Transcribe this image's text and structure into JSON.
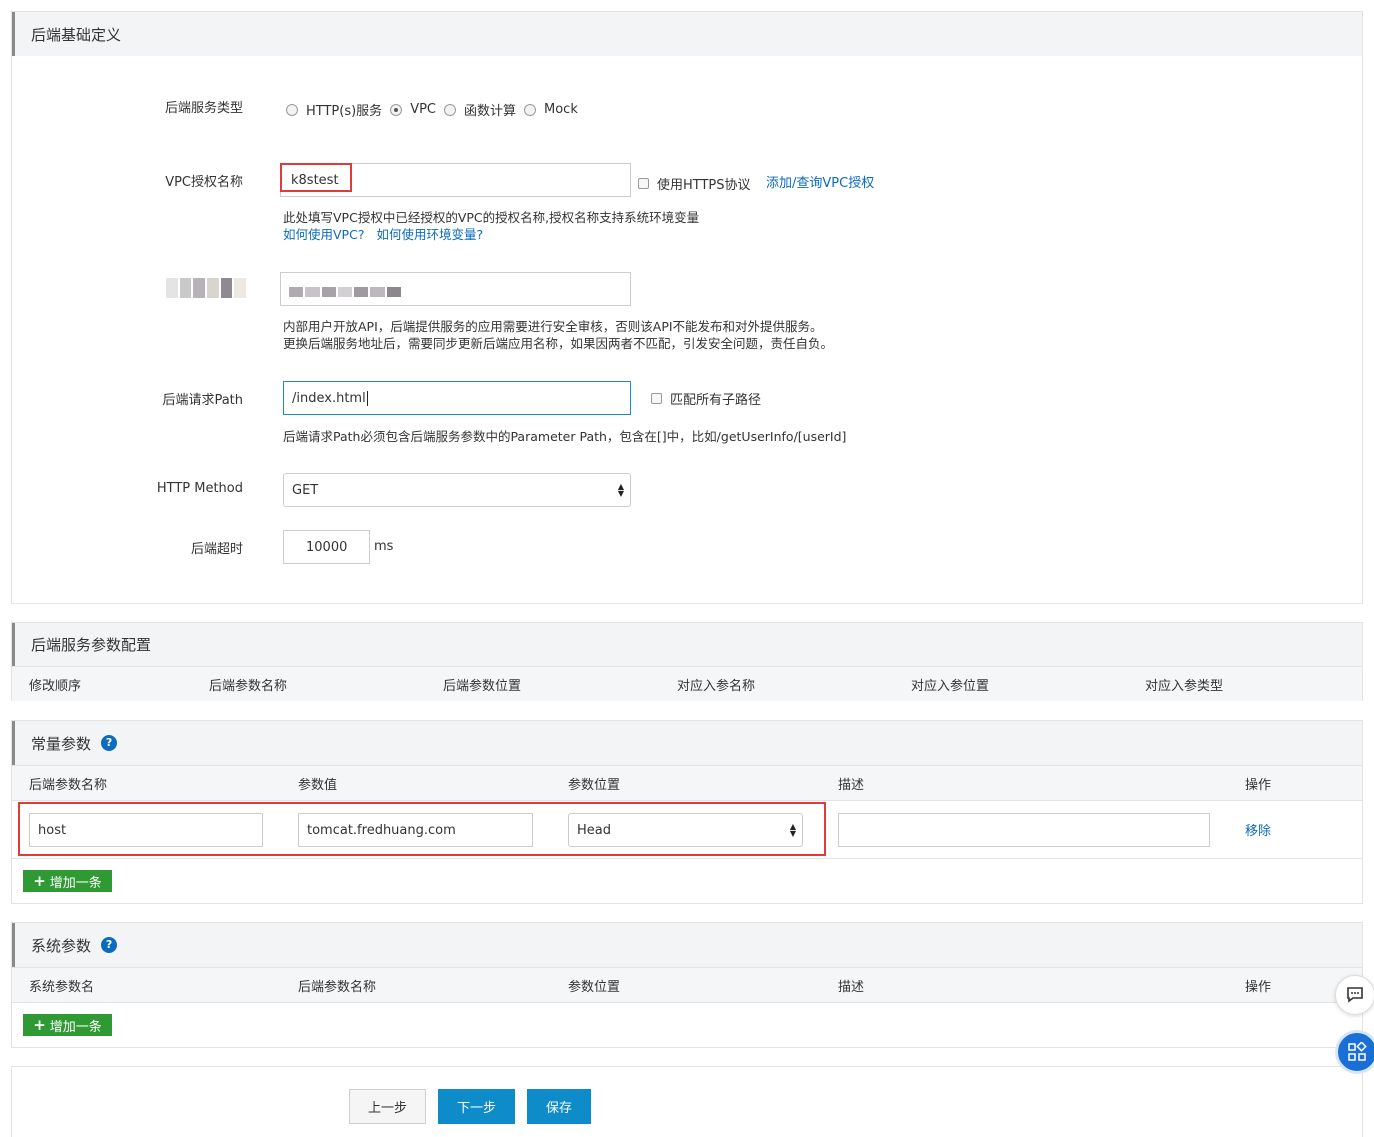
{
  "basic": {
    "title": "后端基础定义",
    "service_type_label": "后端服务类型",
    "service_types": [
      "HTTP(s)服务",
      "VPC",
      "函数计算",
      "Mock"
    ],
    "vpc_label": "VPC授权名称",
    "vpc_value": "k8stest",
    "https_label": "使用HTTPS协议",
    "vpc_link": "添加/查询VPC授权",
    "vpc_hint": "此处填写VPC授权中已经授权的VPC的授权名称,授权名称支持系统环境变量",
    "vpc_help_link1": "如何使用VPC?",
    "vpc_help_link2": "如何使用环境变量?",
    "app_hint": "内部用户开放API，后端提供服务的应用需要进行安全审核，否则该API不能发布和对外提供服务。",
    "app_warning": "更换后端服务地址后，需要同步更新后端应用名称，如果因两者不匹配，引发安全问题，责任自负。",
    "path_label": "后端请求Path",
    "path_value": "/index.html",
    "match_sub_label": "匹配所有子路径",
    "path_hint": "后端请求Path必须包含后端服务参数中的Parameter Path，包含在[]中，比如/getUserInfo/[userId]",
    "method_label": "HTTP Method",
    "method_value": "GET",
    "timeout_label": "后端超时",
    "timeout_value": "10000",
    "timeout_unit": "ms"
  },
  "params": {
    "title": "后端服务参数配置",
    "columns": [
      "修改顺序",
      "后端参数名称",
      "后端参数位置",
      "对应入参名称",
      "对应入参位置",
      "对应入参类型"
    ]
  },
  "constants": {
    "title": "常量参数",
    "help": "?",
    "columns": [
      "后端参数名称",
      "参数值",
      "参数位置",
      "描述",
      "操作"
    ],
    "row": {
      "name": "host",
      "value": "tomcat.fredhuang.com",
      "location": "Head",
      "description": "",
      "action": "移除"
    },
    "add_label": "增加一条"
  },
  "system": {
    "title": "系统参数",
    "help": "?",
    "columns": [
      "系统参数名",
      "后端参数名称",
      "参数位置",
      "描述",
      "操作"
    ],
    "add_label": "增加一条"
  },
  "footer": {
    "prev": "上一步",
    "next": "下一步",
    "save": "保存"
  },
  "colors": {
    "green": "#2f9a33",
    "blue": "#0a6bbf",
    "primary_btn": "#0e8cc9",
    "highlight": "#e03a3a"
  }
}
